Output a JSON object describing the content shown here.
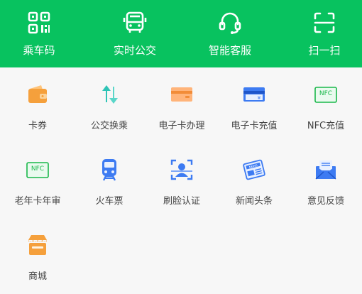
{
  "header": {
    "items": [
      {
        "label": "乘车码",
        "icon": "qr-code-icon"
      },
      {
        "label": "实时公交",
        "icon": "bus-icon"
      },
      {
        "label": "智能客服",
        "icon": "headset-icon"
      },
      {
        "label": "扫一扫",
        "icon": "scan-icon"
      }
    ],
    "bg_color": "#08c25f"
  },
  "services": {
    "items": [
      {
        "label": "卡券",
        "icon": "wallet-icon",
        "color": "#f5a03c"
      },
      {
        "label": "公交换乘",
        "icon": "transfer-arrows-icon",
        "color": "#2ec4b6"
      },
      {
        "label": "电子卡办理",
        "icon": "card-icon",
        "color": "#f28c38"
      },
      {
        "label": "电子卡充值",
        "icon": "card-yuan-icon",
        "color": "#3d7bf2"
      },
      {
        "label": "NFC充值",
        "icon": "nfc-icon",
        "color": "#19b84a",
        "badge": "NFC"
      },
      {
        "label": "老年卡年审",
        "icon": "nfc-icon",
        "color": "#19b84a",
        "badge": "NFC"
      },
      {
        "label": "火车票",
        "icon": "train-icon",
        "color": "#3d7bf2"
      },
      {
        "label": "刷脸认证",
        "icon": "face-scan-icon",
        "color": "#3d7bf2"
      },
      {
        "label": "新闻头条",
        "icon": "newspaper-icon",
        "color": "#3d7bf2",
        "badge": "NEWS"
      },
      {
        "label": "意见反馈",
        "icon": "mail-icon",
        "color": "#3d7bf2"
      },
      {
        "label": "商城",
        "icon": "store-icon",
        "color": "#f5a03c"
      }
    ]
  }
}
